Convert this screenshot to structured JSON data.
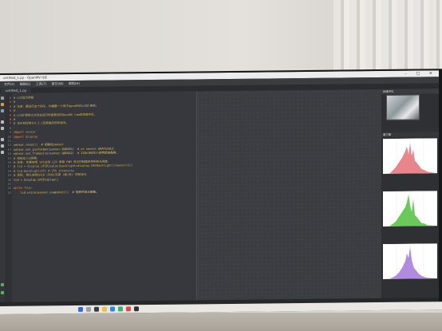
{
  "window": {
    "title": "untitled_1.py - OpenMV IDE",
    "controls": [
      "–",
      "□",
      "✕"
    ]
  },
  "menubar": {
    "items": [
      "文件(F)",
      "编辑(E)",
      "工具(T)",
      "窗口(W)",
      "帮助(H)"
    ]
  },
  "tabs": [
    {
      "label": "untitled_1.py"
    }
  ],
  "tabbar_info": "",
  "editor": {
    "lines": [
      {
        "n": "1",
        "cls": "c-comment",
        "text": "# LCD显示例程"
      },
      {
        "n": "2",
        "cls": "c-comment",
        "text": "#"
      },
      {
        "n": "3",
        "cls": "c-comment",
        "text": "# 注意：要运行这个例子，你需要一个用于OpenMV的LCD扩展板。"
      },
      {
        "n": "4",
        "cls": "c-comment",
        "text": "#"
      },
      {
        "n": "5",
        "cls": "c-comment",
        "text": "# LCD扩展板允许您在运行时查看您的OpenMV Cam的帧缓冲区。"
      },
      {
        "n": "6",
        "cls": "c-comment",
        "text": "#"
      },
      {
        "n": "7",
        "cls": "c-comment",
        "text": "# 该示例适用于4.5.1及更高的固件版本。"
      },
      {
        "n": "8",
        "cls": "c-comment",
        "text": ""
      },
      {
        "n": "9",
        "cls": "c-kw",
        "text": "import sensor"
      },
      {
        "n": "10",
        "cls": "c-kw",
        "text": "import display"
      },
      {
        "n": "11",
        "cls": "c-def",
        "text": ""
      },
      {
        "n": "12",
        "cls": "c-fn",
        "text": "sensor.reset()  # 初始化sensor"
      },
      {
        "n": "13",
        "cls": "c-fn",
        "text": "sensor.set_pixformat(sensor.RGB565)  # or sensor.GRAYSCALE"
      },
      {
        "n": "14",
        "cls": "c-fn",
        "text": "sensor.set_framesize(sensor.QQVGA2)  # 128x160大小的特定液晶屏。"
      },
      {
        "n": "15",
        "cls": "c-comment",
        "text": "# 初始化lcd屏幕。"
      },
      {
        "n": "16",
        "cls": "c-comment",
        "text": "# 注意: 如果使用 SPI总线 LCD 屏幕 PWM 背光控制器来控制背光亮度"
      },
      {
        "n": "17",
        "cls": "c-comment",
        "text": "# lcd = display.SPIDisplay(backlight=display.DACBacklight(channel=2))"
      },
      {
        "n": "18",
        "cls": "c-comment",
        "text": "# lcd.backlight(25) # 25% intensity"
      },
      {
        "n": "19",
        "cls": "c-comment",
        "text": "# 否则, 默认使用GPIO (PD0)引脚 (高/低) 控制背光"
      },
      {
        "n": "20",
        "cls": "c-fn",
        "text": "lcd = display.SPIDisplay()"
      },
      {
        "n": "21",
        "cls": "c-def",
        "text": ""
      },
      {
        "n": "22",
        "cls": "c-kw",
        "text": "while True:"
      },
      {
        "n": "23",
        "cls": "c-fn",
        "text": "    lcd.write(sensor.snapshot())  # 拍照并显示图像。"
      }
    ]
  },
  "right_panel": {
    "framebuffer_title": "帧缓冲区",
    "histogram_title": "直方图",
    "histogram_space": "",
    "histograms": [
      {
        "channel": "R",
        "color": "#e8868c",
        "stats_top": "",
        "stats_bottom": ""
      },
      {
        "channel": "G",
        "color": "#69c95b",
        "stats_top": "",
        "stats_bottom": ""
      },
      {
        "channel": "B",
        "color": "#b08be0",
        "stats_top": "",
        "stats_bottom": ""
      }
    ]
  },
  "statusbar": {
    "left": "",
    "board": "",
    "port": "",
    "sensor": "",
    "firmware": "",
    "serial": "",
    "fps": ""
  },
  "taskbar": {
    "time": "",
    "date": ""
  },
  "colors": {
    "editor_bg": "#36383d",
    "comment": "#d7b24a",
    "keyword": "#e59a4d",
    "highlight": "#5a4a2a"
  }
}
